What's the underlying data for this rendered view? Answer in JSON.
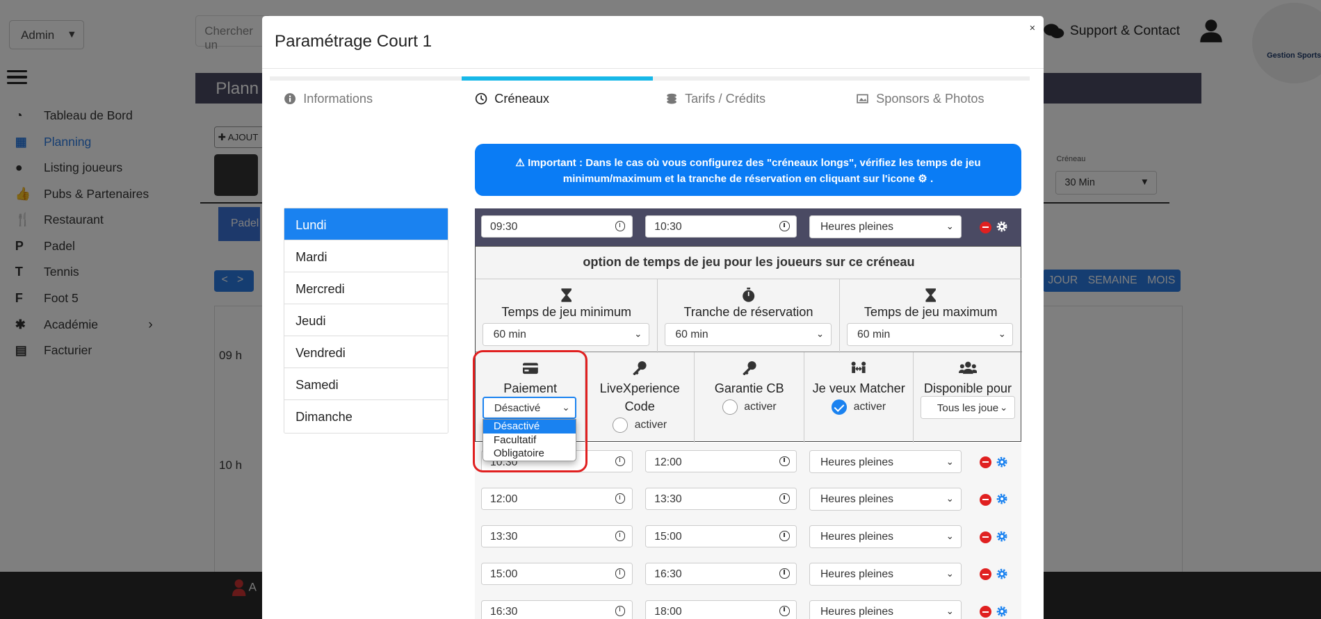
{
  "background": {
    "admin_select": "Admin",
    "search_placeholder": "Chercher un",
    "planning_title": "Plann",
    "support_label": "Support & Contact",
    "logo_text": "Gestion Sports",
    "add_button": "AJOUT",
    "padel_tab": "Padel",
    "nav_prev": "<",
    "nav_next": ">",
    "views": [
      "JOUR",
      "SEMAINE",
      "MOIS"
    ],
    "creneau_label": "Créneau",
    "creneau_value": "30 Min",
    "hours": [
      "09 h",
      "10 h"
    ],
    "footer_user": "A",
    "sidebar": [
      {
        "label": "Tableau de Bord",
        "icon": "dashboard-icon"
      },
      {
        "label": "Planning",
        "icon": "calendar-icon"
      },
      {
        "label": "Listing joueurs",
        "icon": "user-icon"
      },
      {
        "label": "Pubs & Partenaires",
        "icon": "thumbs-up-icon"
      },
      {
        "label": "Restaurant",
        "icon": "utensils-icon"
      },
      {
        "label": "Padel",
        "icon": "letter-p-icon"
      },
      {
        "label": "Tennis",
        "icon": "letter-t-icon"
      },
      {
        "label": "Foot 5",
        "icon": "letter-f-icon"
      },
      {
        "label": "Académie",
        "icon": "academy-icon"
      },
      {
        "label": "Facturier",
        "icon": "invoice-icon"
      }
    ],
    "sidebar_glyphs": [
      "◔",
      "▦",
      "●",
      "👍",
      "🍴",
      "P",
      "T",
      "F",
      "✱",
      "▤"
    ],
    "sidebar_active": "Planning",
    "accent": "#2a7ae2"
  },
  "modal": {
    "title": "Paramétrage Court 1",
    "close": "×",
    "tabs": [
      {
        "label": "Informations",
        "icon": "info-icon"
      },
      {
        "label": "Créneaux",
        "icon": "clock-icon"
      },
      {
        "label": "Tarifs / Crédits",
        "icon": "coins-icon"
      },
      {
        "label": "Sponsors & Photos",
        "icon": "images-icon"
      }
    ],
    "active_tab": "Créneaux",
    "days": [
      "Lundi",
      "Mardi",
      "Mercredi",
      "Jeudi",
      "Vendredi",
      "Samedi",
      "Dimanche"
    ],
    "active_day": "Lundi",
    "alert_strong": "Important :",
    "alert_text1": "Dans le cas où vous configurez des \"créneaux longs\", vérifiez les temps de jeu",
    "alert_text2": "minimum/maximum et la tranche de réservation en cliquant sur l'icone",
    "main_slot": {
      "start": "09:30",
      "end": "10:30",
      "mode": "Heures pleines"
    },
    "options_title": "option de temps de jeu pour les joueurs sur ce créneau",
    "time_options": [
      {
        "label": "Temps de jeu minimum",
        "value": "60 min",
        "icon": "hourglass-icon"
      },
      {
        "label": "Tranche de réservation",
        "value": "60 min",
        "icon": "stopwatch-icon"
      },
      {
        "label": "Temps de jeu maximum",
        "value": "60 min",
        "icon": "hourglass-icon"
      }
    ],
    "paiement": {
      "label": "Paiement",
      "value": "Désactivé",
      "options": [
        "Désactivé",
        "Facultatif",
        "Obligatoire"
      ]
    },
    "livexperience": {
      "label1": "LiveXperience",
      "label2": "Code",
      "toggle": "activer",
      "checked": false
    },
    "garantie": {
      "label": "Garantie CB",
      "toggle": "activer",
      "checked": false
    },
    "matcher": {
      "label": "Je veux Matcher",
      "toggle": "activer",
      "checked": true
    },
    "disponible": {
      "label": "Disponible pour",
      "value": "Tous les joue"
    },
    "slots": [
      {
        "start": "10:30",
        "end": "12:00",
        "mode": "Heures pleines"
      },
      {
        "start": "12:00",
        "end": "13:30",
        "mode": "Heures pleines"
      },
      {
        "start": "13:30",
        "end": "15:00",
        "mode": "Heures pleines"
      },
      {
        "start": "15:00",
        "end": "16:30",
        "mode": "Heures pleines"
      },
      {
        "start": "16:30",
        "end": "18:00",
        "mode": "Heures pleines"
      }
    ],
    "alert_color": "#0a7cf5",
    "highlight_color": "#e02020"
  }
}
